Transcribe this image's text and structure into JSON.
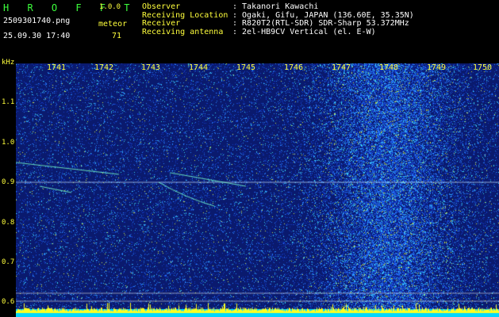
{
  "header": {
    "app_name": "H R O F F T",
    "version": "1.0.0",
    "filename": "2509301740.png",
    "datetime": "25.09.30 17:40",
    "meteor_label": "meteor",
    "meteor_count": "71"
  },
  "station": {
    "observer_label": "Observer",
    "observer_value": ": Takanori Kawachi",
    "location_label": "Receiving Location",
    "location_value": ": Ogaki, Gifu, JAPAN (136.60E, 35.35N)",
    "receiver_label": "Receiver",
    "receiver_value": ": R820T2(RTL-SDR) SDR-Sharp 53.372MHz",
    "antenna_label": "Receiving antenna",
    "antenna_value": ": 2el-HB9CV Vertical (el. E-W)"
  },
  "spectrogram": {
    "y_unit": "kHz",
    "y_ticks": [
      "1.1",
      "1.0",
      "0.9",
      "0.8",
      "0.7",
      "0.6"
    ],
    "x_ticks": [
      "1741",
      "1742",
      "1743",
      "1744",
      "1745",
      "1746",
      "1747",
      "1748",
      "1749",
      "1750"
    ]
  },
  "colors": {
    "label_yellow": "#ffff3c",
    "title_green": "#3cff3c",
    "background_blue": "#0a1a6e",
    "baseline_cyan": "#00d8ff"
  }
}
